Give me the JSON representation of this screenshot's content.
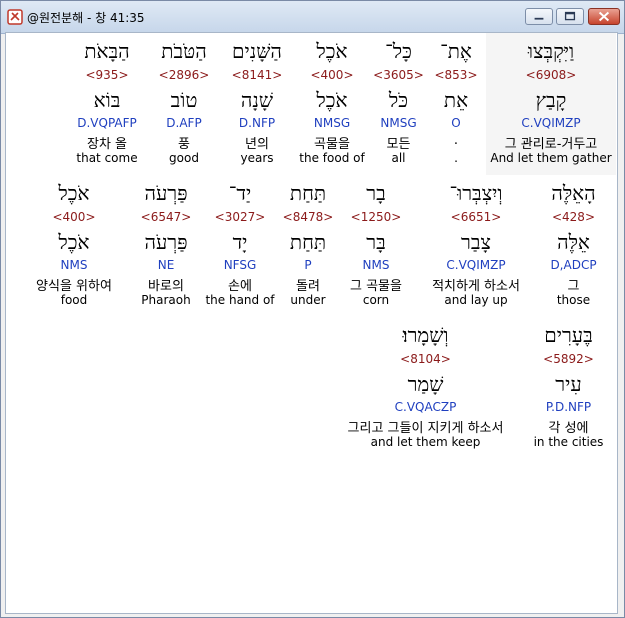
{
  "window": {
    "title": "@원전분해 - 창 41:35",
    "colors": {
      "hebrew": "#000000",
      "strong": "#8b1a1a",
      "parse": "#1f3fbf"
    }
  },
  "words": [
    {
      "heb": "וַיִּקְבְּצוּ",
      "num": "<6908>",
      "root": "קָבַץ",
      "parse": "C.VQIMZP",
      "kor": "그 관리로-거두고",
      "eng": "And let them gather"
    },
    {
      "heb": "אֶת־",
      "num": "<853>",
      "root": "אֵת",
      "parse": "O",
      "kor": ".",
      "eng": "."
    },
    {
      "heb": "כָּל־",
      "num": "<3605>",
      "root": "כֹּל",
      "parse": "NMSG",
      "kor": "모든",
      "eng": "all"
    },
    {
      "heb": "אֹכֶל",
      "num": "<400>",
      "root": "אֹכֶל",
      "parse": "NMSG",
      "kor": "곡물을",
      "eng": "the food of"
    },
    {
      "heb": "הַשָּׁנִים",
      "num": "<8141>",
      "root": "שָׁנָה",
      "parse": "D.NFP",
      "kor": "년의",
      "eng": "years"
    },
    {
      "heb": "הַטֹּבֹת",
      "num": "<2896>",
      "root": "טוֹב",
      "parse": "D.AFP",
      "kor": "풍",
      "eng": "good"
    },
    {
      "heb": "הַבָּאֹת",
      "num": "<935>",
      "root": "בּוֹא",
      "parse": "D.VQPAFP",
      "kor": "장차 올",
      "eng": "that come"
    },
    {
      "heb": "הָאֵלֶּה",
      "num": "<428>",
      "root": "אֵלֶּה",
      "parse": "D,ADCP",
      "kor": "그",
      "eng": "those"
    },
    {
      "heb": "וְיִצְבְּרוּ־",
      "num": "<6651>",
      "root": "צָבַר",
      "parse": "C.VQIMZP",
      "kor": "적치하게 하소서",
      "eng": "and lay up"
    },
    {
      "heb": "בָר",
      "num": "<1250>",
      "root": "בָּר",
      "parse": "NMS",
      "kor": "그 곡물을",
      "eng": "corn"
    },
    {
      "heb": "תַּחַת",
      "num": "<8478>",
      "root": "תַּחַת",
      "parse": "P",
      "kor": "돌려",
      "eng": "under"
    },
    {
      "heb": "יַד־",
      "num": "<3027>",
      "root": "יָד",
      "parse": "NFSG",
      "kor": "손에",
      "eng": "the hand of"
    },
    {
      "heb": "פַּרְעֹה",
      "num": "<6547>",
      "root": "פַּרְעֹה",
      "parse": "NE",
      "kor": "바로의",
      "eng": "Pharaoh"
    },
    {
      "heb": "אֹכֶל",
      "num": "<400>",
      "root": "אֹכֶל",
      "parse": "NMS",
      "kor": "양식을 위하여",
      "eng": "food"
    },
    {
      "heb": "בֶּעָרִים",
      "num": "<5892>",
      "root": "עִיר",
      "parse": "P.D.NFP",
      "kor": "각 성에",
      "eng": "in the cities"
    },
    {
      "heb": "וְשָׁמָרוּ׃",
      "num": "<8104>",
      "root": "שָׁמַר",
      "parse": "C.VQACZP",
      "kor": "그리고 그들이 지키게 하소서",
      "eng": "and let them keep"
    }
  ]
}
